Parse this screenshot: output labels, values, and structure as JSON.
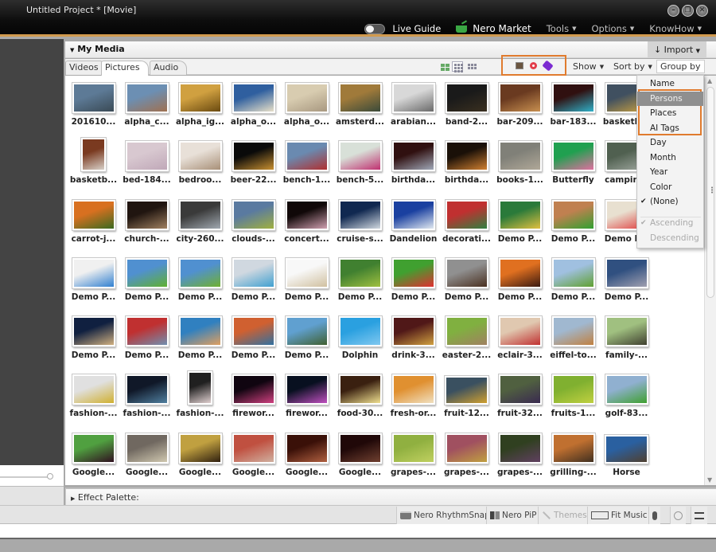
{
  "window": {
    "title": "Untitled Project * [Movie]",
    "controls": [
      "minimize",
      "restore",
      "close"
    ]
  },
  "menubar": {
    "live_guide": "Live Guide",
    "nero_market": "Nero Market",
    "tools": "Tools",
    "options": "Options",
    "knowhow": "KnowHow"
  },
  "media": {
    "title": "My Media",
    "import": "Import",
    "tabs": [
      "Videos",
      "Pictures",
      "Audio"
    ],
    "active_tab": "Pictures",
    "show": "Show",
    "sort_by": "Sort by",
    "group_by": "Group by",
    "group_icons": [
      "persons-icon",
      "places-icon",
      "ai-tags-icon"
    ],
    "items": [
      {
        "label": "201610...",
        "colors": [
          "#5d7a96",
          "#3a4a55"
        ]
      },
      {
        "label": "alpha_c...",
        "colors": [
          "#6c8fb3",
          "#a07050"
        ]
      },
      {
        "label": "alpha_ig...",
        "colors": [
          "#d0a040",
          "#6a4a10"
        ]
      },
      {
        "label": "alpha_o...",
        "colors": [
          "#2f5f9f",
          "#e8e0c8"
        ]
      },
      {
        "label": "alpha_o...",
        "colors": [
          "#d8ccb0",
          "#a89880"
        ]
      },
      {
        "label": "amsterd...",
        "colors": [
          "#a07a3a",
          "#3a4a3a"
        ]
      },
      {
        "label": "arabian...",
        "colors": [
          "#d8d8d8",
          "#6a6a6a"
        ]
      },
      {
        "label": "band-2...",
        "colors": [
          "#1a1a1a",
          "#3a3020"
        ]
      },
      {
        "label": "bar-209...",
        "colors": [
          "#6a3a20",
          "#c89050"
        ]
      },
      {
        "label": "bar-183...",
        "colors": [
          "#301010",
          "#30b0c8"
        ]
      },
      {
        "label": "basketb...",
        "colors": [
          "#405060",
          "#c8a040"
        ]
      },
      {
        "label": "basketb...",
        "colors": [
          "#7a3a20",
          "#d8d0c8"
        ],
        "shape": "tall"
      },
      {
        "label": "bed-184...",
        "colors": [
          "#d8c8d0",
          "#c0a8b8"
        ]
      },
      {
        "label": "bedroo...",
        "colors": [
          "#e8e0d8",
          "#a89078"
        ]
      },
      {
        "label": "beer-22...",
        "colors": [
          "#0a0a0a",
          "#c89030"
        ]
      },
      {
        "label": "bench-1...",
        "colors": [
          "#6a8ab0",
          "#b03030"
        ]
      },
      {
        "label": "bench-5...",
        "colors": [
          "#d8e0d8",
          "#c03070"
        ]
      },
      {
        "label": "birthda...",
        "colors": [
          "#301010",
          "#a0a8b8"
        ]
      },
      {
        "label": "birthda...",
        "colors": [
          "#1a1008",
          "#d08030"
        ]
      },
      {
        "label": "books-1...",
        "colors": [
          "#808078",
          "#b0a898"
        ]
      },
      {
        "label": "Butterfly",
        "colors": [
          "#20a050",
          "#e070a0"
        ]
      },
      {
        "label": "campin...",
        "colors": [
          "#506050",
          "#a0a8a0"
        ]
      },
      {
        "label": "carrot-j...",
        "colors": [
          "#d87020",
          "#3a6a20"
        ]
      },
      {
        "label": "church-...",
        "colors": [
          "#201510",
          "#a08060"
        ]
      },
      {
        "label": "city-260...",
        "colors": [
          "#3a3a3a",
          "#a0a8b0"
        ]
      },
      {
        "label": "clouds-...",
        "colors": [
          "#5a7aa0",
          "#a0b040"
        ]
      },
      {
        "label": "concert...",
        "colors": [
          "#100808",
          "#d0a0b0"
        ]
      },
      {
        "label": "cruise-s...",
        "colors": [
          "#102850",
          "#d0d8e0"
        ]
      },
      {
        "label": "Dandelion",
        "colors": [
          "#1a40a0",
          "#e0e8f0"
        ]
      },
      {
        "label": "decorati...",
        "colors": [
          "#c03030",
          "#308040"
        ]
      },
      {
        "label": "Demo P...",
        "colors": [
          "#2a7a3a",
          "#e0c040"
        ]
      },
      {
        "label": "Demo P...",
        "colors": [
          "#c08050",
          "#30a030"
        ]
      },
      {
        "label": "Demo P...",
        "colors": [
          "#e8e0d0",
          "#e04040"
        ]
      },
      {
        "label": "Demo P...",
        "colors": [
          "#f0f0f0",
          "#3080d0"
        ]
      },
      {
        "label": "Demo P...",
        "colors": [
          "#5090d0",
          "#60b030"
        ]
      },
      {
        "label": "Demo P...",
        "colors": [
          "#5090d0",
          "#70b030"
        ]
      },
      {
        "label": "Demo P...",
        "colors": [
          "#d0d8e0",
          "#40a0d0"
        ]
      },
      {
        "label": "Demo P...",
        "colors": [
          "#f8f8f8",
          "#d0c0a0"
        ]
      },
      {
        "label": "Demo P...",
        "colors": [
          "#408030",
          "#a0c040"
        ]
      },
      {
        "label": "Demo P...",
        "colors": [
          "#40a030",
          "#e03030"
        ]
      },
      {
        "label": "Demo P...",
        "colors": [
          "#909090",
          "#4a3020"
        ]
      },
      {
        "label": "Demo P...",
        "colors": [
          "#e07020",
          "#3a1a10"
        ]
      },
      {
        "label": "Demo P...",
        "colors": [
          "#a0c0e0",
          "#60a030"
        ]
      },
      {
        "label": "Demo P...",
        "colors": [
          "#305080",
          "#a0a0b0"
        ]
      },
      {
        "label": "Demo P...",
        "colors": [
          "#102040",
          "#d0b080"
        ]
      },
      {
        "label": "Demo P...",
        "colors": [
          "#c03030",
          "#7090b0"
        ]
      },
      {
        "label": "Demo P...",
        "colors": [
          "#3080c0",
          "#e0a060"
        ]
      },
      {
        "label": "Demo P...",
        "colors": [
          "#d06030",
          "#3070a0"
        ]
      },
      {
        "label": "Demo P...",
        "colors": [
          "#60a0d0",
          "#406030"
        ]
      },
      {
        "label": "Dolphin",
        "colors": [
          "#2aa0e0",
          "#80c8f0"
        ]
      },
      {
        "label": "drink-3...",
        "colors": [
          "#501818",
          "#d0a040"
        ]
      },
      {
        "label": "easter-2...",
        "colors": [
          "#80b040",
          "#a08060"
        ]
      },
      {
        "label": "eclair-3...",
        "colors": [
          "#e0c8b0",
          "#c03030"
        ]
      },
      {
        "label": "eiffel-to...",
        "colors": [
          "#a0b8d0",
          "#c08040"
        ]
      },
      {
        "label": "family-...",
        "colors": [
          "#a0c080",
          "#404030"
        ]
      },
      {
        "label": "fashion-...",
        "colors": [
          "#e0e0e0",
          "#d0b030"
        ]
      },
      {
        "label": "fashion-...",
        "colors": [
          "#101828",
          "#5080a0"
        ]
      },
      {
        "label": "fashion-...",
        "colors": [
          "#202020",
          "#e0d0d0"
        ],
        "shape": "tall"
      },
      {
        "label": "firewor...",
        "colors": [
          "#100510",
          "#d04080"
        ]
      },
      {
        "label": "firewor...",
        "colors": [
          "#081020",
          "#c050c0"
        ]
      },
      {
        "label": "food-30...",
        "colors": [
          "#3a2010",
          "#f0e090"
        ]
      },
      {
        "label": "fresh-or...",
        "colors": [
          "#e09030",
          "#f0e0c0"
        ]
      },
      {
        "label": "fruit-12...",
        "colors": [
          "#3a5060",
          "#d0a030"
        ],
        "shape": "wide"
      },
      {
        "label": "fruit-32...",
        "colors": [
          "#506040",
          "#3a2a50"
        ]
      },
      {
        "label": "fruits-1...",
        "colors": [
          "#80b030",
          "#c0d040"
        ]
      },
      {
        "label": "golf-83...",
        "colors": [
          "#90b0d0",
          "#40a030"
        ]
      },
      {
        "label": "Google...",
        "colors": [
          "#50a040",
          "#301020"
        ]
      },
      {
        "label": "Google...",
        "colors": [
          "#706860",
          "#d0c8b0"
        ]
      },
      {
        "label": "Google...",
        "colors": [
          "#c0a040",
          "#302010"
        ]
      },
      {
        "label": "Google...",
        "colors": [
          "#c05040",
          "#d0b0a0"
        ]
      },
      {
        "label": "Google...",
        "colors": [
          "#3a1008",
          "#b06040"
        ]
      },
      {
        "label": "Google...",
        "colors": [
          "#200808",
          "#704030"
        ]
      },
      {
        "label": "grapes-...",
        "colors": [
          "#90b040",
          "#c0d060"
        ]
      },
      {
        "label": "grapes-...",
        "colors": [
          "#a05060",
          "#c0a040"
        ]
      },
      {
        "label": "grapes-...",
        "colors": [
          "#304020",
          "#604060"
        ]
      },
      {
        "label": "grilling-...",
        "colors": [
          "#c07030",
          "#403020"
        ]
      },
      {
        "label": "Horse",
        "colors": [
          "#2a60a0",
          "#504030"
        ],
        "shape": "wide"
      }
    ]
  },
  "groupby_menu": {
    "items": [
      {
        "label": "Name",
        "state": "normal"
      },
      {
        "label": "Persons",
        "state": "highlighted"
      },
      {
        "label": "Places",
        "state": "normal"
      },
      {
        "label": "AI Tags",
        "state": "normal"
      },
      {
        "label": "Day",
        "state": "normal"
      },
      {
        "label": "Month",
        "state": "normal"
      },
      {
        "label": "Year",
        "state": "normal"
      },
      {
        "label": "Color",
        "state": "normal"
      },
      {
        "label": "(None)",
        "state": "checked"
      },
      {
        "label": "Ascending",
        "state": "checked-disabled"
      },
      {
        "label": "Descending",
        "state": "disabled"
      }
    ]
  },
  "effect_palette": {
    "label": "Effect Palette:"
  },
  "bottom_toolbar": {
    "rhythmsnap": "Nero RhythmSnap",
    "pip": "Nero PiP",
    "themes": "Themes",
    "fit_music": "Fit Music"
  },
  "accent": {
    "highlight_box": "#e07b2e",
    "title_underline": "#d19a4e"
  }
}
